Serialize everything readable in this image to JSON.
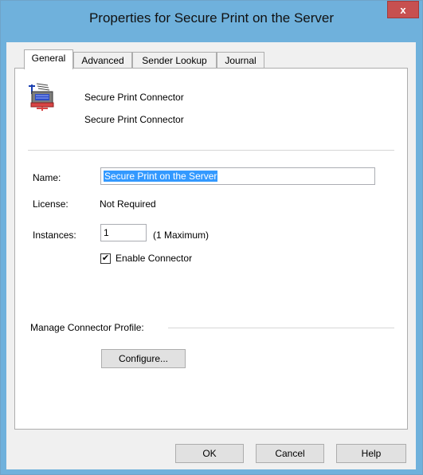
{
  "window": {
    "title": "Properties for Secure Print on the Server",
    "close_label": "x"
  },
  "tabs": [
    {
      "label": "General",
      "active": true
    },
    {
      "label": "Advanced",
      "active": false
    },
    {
      "label": "Sender Lookup",
      "active": false
    },
    {
      "label": "Journal",
      "active": false
    }
  ],
  "connector": {
    "icon": "printer-connector-icon",
    "line1": "Secure Print Connector",
    "line2": "Secure Print Connector"
  },
  "fields": {
    "name_label": "Name:",
    "name_value": "Secure Print on the Server",
    "license_label": "License:",
    "license_value": "Not Required",
    "instances_label": "Instances:",
    "instances_value": "1",
    "instances_max": "(1 Maximum)",
    "enable_label": "Enable Connector",
    "enable_checked": true
  },
  "profile": {
    "label": "Manage Connector Profile:",
    "configure_label": "Configure..."
  },
  "footer": {
    "ok_label": "OK",
    "cancel_label": "Cancel",
    "help_label": "Help"
  }
}
